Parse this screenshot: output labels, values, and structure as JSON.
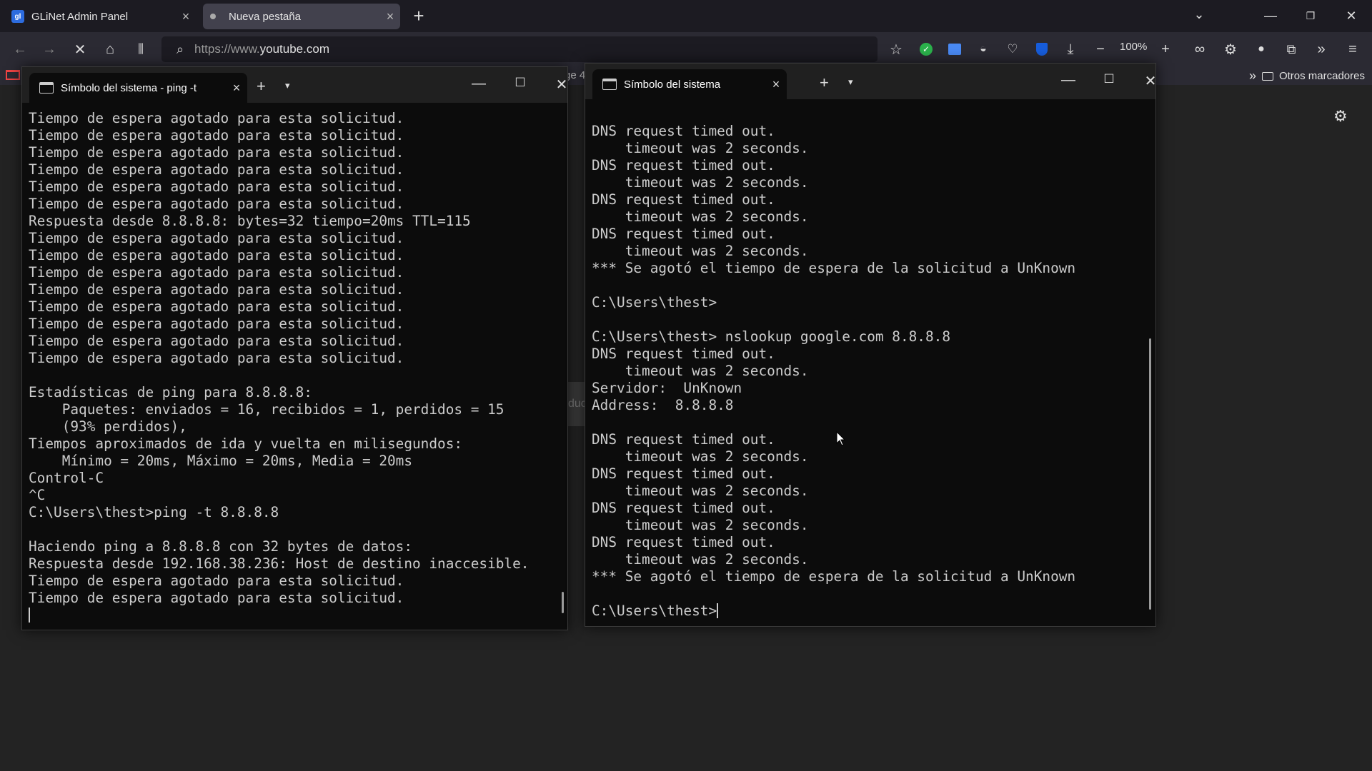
{
  "browser": {
    "tabs": [
      {
        "label": "GLiNet Admin Panel",
        "favicon": "gl"
      },
      {
        "label": "Nueva pestaña"
      }
    ],
    "url_prefix": "https://www.",
    "url_domain": "youtube.com",
    "zoom": "100%",
    "bookmarks_other": "Otros marcadores",
    "background_peek_1": "ge 4",
    "background_peek_2": "duc"
  },
  "terminal_left": {
    "tab_title": "Símbolo del sistema - ping  -t",
    "lines": [
      "Tiempo de espera agotado para esta solicitud.",
      "Tiempo de espera agotado para esta solicitud.",
      "Tiempo de espera agotado para esta solicitud.",
      "Tiempo de espera agotado para esta solicitud.",
      "Tiempo de espera agotado para esta solicitud.",
      "Tiempo de espera agotado para esta solicitud.",
      "Respuesta desde 8.8.8.8: bytes=32 tiempo=20ms TTL=115",
      "Tiempo de espera agotado para esta solicitud.",
      "Tiempo de espera agotado para esta solicitud.",
      "Tiempo de espera agotado para esta solicitud.",
      "Tiempo de espera agotado para esta solicitud.",
      "Tiempo de espera agotado para esta solicitud.",
      "Tiempo de espera agotado para esta solicitud.",
      "Tiempo de espera agotado para esta solicitud.",
      "Tiempo de espera agotado para esta solicitud.",
      "",
      "Estadísticas de ping para 8.8.8.8:",
      "    Paquetes: enviados = 16, recibidos = 1, perdidos = 15",
      "    (93% perdidos),",
      "Tiempos aproximados de ida y vuelta en milisegundos:",
      "    Mínimo = 20ms, Máximo = 20ms, Media = 20ms",
      "Control-C",
      "^C",
      "C:\\Users\\thest>ping -t 8.8.8.8",
      "",
      "Haciendo ping a 8.8.8.8 con 32 bytes de datos:",
      "Respuesta desde 192.168.38.236: Host de destino inaccesible.",
      "Tiempo de espera agotado para esta solicitud.",
      "Tiempo de espera agotado para esta solicitud."
    ]
  },
  "terminal_right": {
    "tab_title": "Símbolo del sistema",
    "lines": [
      "DNS request timed out.",
      "    timeout was 2 seconds.",
      "DNS request timed out.",
      "    timeout was 2 seconds.",
      "DNS request timed out.",
      "    timeout was 2 seconds.",
      "DNS request timed out.",
      "    timeout was 2 seconds.",
      "*** Se agotó el tiempo de espera de la solicitud a UnKnown",
      "",
      "C:\\Users\\thest>",
      "",
      "C:\\Users\\thest> nslookup google.com 8.8.8.8",
      "DNS request timed out.",
      "    timeout was 2 seconds.",
      "Servidor:  UnKnown",
      "Address:  8.8.8.8",
      "",
      "DNS request timed out.",
      "    timeout was 2 seconds.",
      "DNS request timed out.",
      "    timeout was 2 seconds.",
      "DNS request timed out.",
      "    timeout was 2 seconds.",
      "DNS request timed out.",
      "    timeout was 2 seconds.",
      "*** Se agotó el tiempo de espera de la solicitud a UnKnown",
      ""
    ],
    "prompt": "C:\\Users\\thest>"
  }
}
